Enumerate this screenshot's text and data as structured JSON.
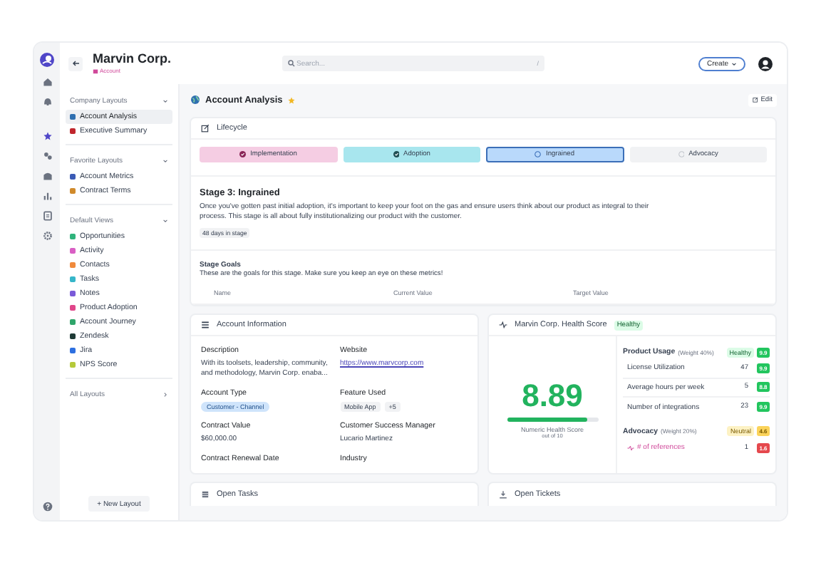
{
  "account": {
    "name": "Marvin Corp.",
    "type": "Account"
  },
  "search": {
    "placeholder": "Search...",
    "shortcut": "/"
  },
  "create_button": "Create",
  "sidebar": {
    "sections": [
      {
        "title": "Company Layouts",
        "expanded": true,
        "items": [
          {
            "label": "Account Analysis",
            "selected": true,
            "color": "#2f6fb0"
          },
          {
            "label": "Executive Summary",
            "selected": false,
            "color": "#c0262d"
          }
        ]
      },
      {
        "title": "Favorite Layouts",
        "expanded": true,
        "items": [
          {
            "label": "Account Metrics",
            "selected": false,
            "color": "#3b5bb5"
          },
          {
            "label": "Contract Terms",
            "selected": false,
            "color": "#d08a2b"
          }
        ]
      },
      {
        "title": "Default Views",
        "expanded": true,
        "items": [
          {
            "label": "Opportunities",
            "selected": false,
            "color": "#2fb37c"
          },
          {
            "label": "Activity",
            "selected": false,
            "color": "#d95fc4"
          },
          {
            "label": "Contacts",
            "selected": false,
            "color": "#f08a3c"
          },
          {
            "label": "Tasks",
            "selected": false,
            "color": "#36b6c9"
          },
          {
            "label": "Notes",
            "selected": false,
            "color": "#7a5ad8"
          },
          {
            "label": "Product Adoption",
            "selected": false,
            "color": "#e0468a"
          },
          {
            "label": "Account Journey",
            "selected": false,
            "color": "#2fa56a"
          },
          {
            "label": "Zendesk",
            "selected": false,
            "color": "#1f3b36"
          },
          {
            "label": "Jira",
            "selected": false,
            "color": "#2d6fe0"
          },
          {
            "label": "NPS Score",
            "selected": false,
            "color": "#b5c93a"
          }
        ]
      },
      {
        "title": "All Layouts",
        "expanded": false
      }
    ],
    "new_layout_button": "+ New Layout"
  },
  "page": {
    "title": "Account Analysis",
    "favorite": true,
    "edit_button": "Edit"
  },
  "lifecycle": {
    "title": "Lifecycle",
    "stages": [
      {
        "label": "Implementation",
        "done": true,
        "selected": false,
        "color": "#f5cde3"
      },
      {
        "label": "Adoption",
        "done": true,
        "selected": false,
        "color": "#a8e6ee"
      },
      {
        "label": "Ingrained",
        "done": false,
        "selected": true,
        "color": "#b9d9fb"
      },
      {
        "label": "Advocacy",
        "done": false,
        "selected": false,
        "color": "#f1f2f4"
      }
    ],
    "stage_title": "Stage 3: Ingrained",
    "description": "Once you've gotten past initial adoption, it's important to keep your foot on the gas and ensure users think about our product as integral to their process. This stage is all about fully institutionalizing our product with the customer.",
    "days_badge": "48 days in stage",
    "goals_title": "Stage Goals",
    "goals_subtitle": "These are the goals for this stage. Make sure you keep an eye on these metrics!",
    "goals_columns": [
      "Name",
      "Current Value",
      "Target Value"
    ]
  },
  "account_information": {
    "title": "Account Information",
    "fields": [
      {
        "label": "Description",
        "kind": "text",
        "value": "With its toolsets, leadership, community, and methodology, Marvin Corp. enaba..."
      },
      {
        "label": "Website",
        "kind": "link",
        "value": "https://www.marvcorp.com"
      },
      {
        "label": "Account Type",
        "kind": "tag",
        "value": "Customer - Channel"
      },
      {
        "label": "Feature Used",
        "kind": "chips",
        "value": "Mobile App",
        "more": "+5"
      },
      {
        "label": "Contract Value",
        "kind": "text",
        "value": "$60,000.00"
      },
      {
        "label": "Customer Success Manager",
        "kind": "text",
        "value": "Lucario Martinez"
      },
      {
        "label": "Contract Renewal Date",
        "kind": "text"
      },
      {
        "label": "Industry",
        "kind": "text"
      }
    ]
  },
  "health_score": {
    "title": "Marvin Corp. Health Score",
    "status": "Healthy",
    "score": "8.89",
    "level": 0.889,
    "score_label": "Numeric Health Score",
    "score_sublabel": "out of 10",
    "groups": [
      {
        "name": "Product Usage",
        "weight": "(Weight 40%)",
        "status": "Healthy",
        "kind": "good",
        "score": "9.9",
        "metrics": [
          {
            "name": "License Utilization",
            "value": "47",
            "score": "9.9",
            "kind": "good",
            "highlighted": false
          },
          {
            "name": "Average hours per week",
            "value": "5",
            "score": "8.8",
            "kind": "good",
            "highlighted": false
          },
          {
            "name": "Number of integrations",
            "value": "23",
            "score": "9.9",
            "kind": "good",
            "highlighted": false
          }
        ]
      },
      {
        "name": "Advocacy",
        "weight": "(Weight 20%)",
        "status": "Neutral",
        "kind": "neutral",
        "score": "4.6",
        "metrics": [
          {
            "name": "# of references",
            "value": "1",
            "score": "1.6",
            "kind": "poor",
            "highlighted": true
          }
        ]
      }
    ]
  },
  "bottom_cards": [
    {
      "title": "Open Tasks"
    },
    {
      "title": "Open Tickets"
    }
  ]
}
